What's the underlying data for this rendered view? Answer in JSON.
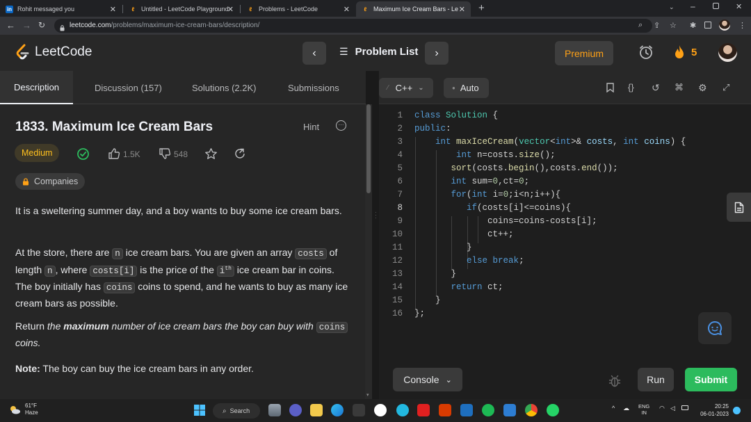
{
  "browser": {
    "tabs": [
      {
        "title": "Rohit messaged you",
        "icon": "linkedin-icon"
      },
      {
        "title": "Untitled - LeetCode Playground",
        "icon": "leetcode-icon"
      },
      {
        "title": "Problems - LeetCode",
        "icon": "leetcode-icon"
      },
      {
        "title": "Maximum Ice Cream Bars - LeetC",
        "icon": "leetcode-icon",
        "active": true
      }
    ],
    "url_host": "leetcode.com",
    "url_path": "/problems/maximum-ice-cream-bars/description/"
  },
  "header": {
    "brand": "LeetCode",
    "problem_list": "Problem List",
    "premium": "Premium",
    "streak": "5",
    "accent": "#ffa116"
  },
  "left_tabs": [
    {
      "label": "Description",
      "active": true
    },
    {
      "label": "Discussion (157)"
    },
    {
      "label": "Solutions (2.2K)"
    },
    {
      "label": "Submissions"
    }
  ],
  "problem": {
    "title": "1833. Maximum Ice Cream Bars",
    "hint": "Hint",
    "difficulty": "Medium",
    "difficulty_color": "#ffc01e",
    "likes": "1.5K",
    "dislikes": "548",
    "companies": "Companies",
    "p1": "It is a sweltering summer day, and a boy wants to buy some ice cream bars.",
    "p2_a": "At the store, there are ",
    "p2_n": "n",
    "p2_b": " ice cream bars. You are given an array ",
    "p2_costs": "costs",
    "p2_c": " of length ",
    "p2_n2": "n",
    "p2_d": ", where ",
    "p2_costsi": "costs[i]",
    "p2_e": " is the price of the ",
    "p2_i": "i",
    "p2_th": "th",
    "p2_f": " ice cream bar in coins. The boy initially has ",
    "p2_coins": "coins",
    "p2_g": " coins to spend, and he wants to buy as many ice cream bars as possible.",
    "p3_a": "Return ",
    "p3_the": "the ",
    "p3_max": "maximum",
    "p3_b": " number of ice cream bars the boy can buy with ",
    "p3_coins": "coins",
    "p3_c": " coins.",
    "note_label": "Note:",
    "note_text": " The boy can buy the ice cream bars in any order."
  },
  "editor": {
    "language": "C++",
    "mode": "Auto",
    "current_line": "8",
    "lines": [
      "class Solution {",
      "public:",
      "    int maxIceCream(vector<int>& costs, int coins) {",
      "        int n=costs.size();",
      "       sort(costs.begin(),costs.end());",
      "       int sum=0,ct=0;",
      "       for(int i=0;i<n;i++){",
      "          if(costs[i]<=coins){",
      "              coins=coins-costs[i];",
      "              ct++;",
      "          }",
      "          else break;",
      "       }",
      "       return ct;",
      "    }",
      "};"
    ]
  },
  "actions": {
    "console": "Console",
    "run": "Run",
    "submit": "Submit",
    "submit_color": "#2cbb5d"
  },
  "taskbar": {
    "temp": "61°F",
    "weather": "Haze",
    "search": "Search",
    "lang1": "ENG",
    "lang2": "IN",
    "time": "20:25",
    "date": "06-01-2023"
  }
}
